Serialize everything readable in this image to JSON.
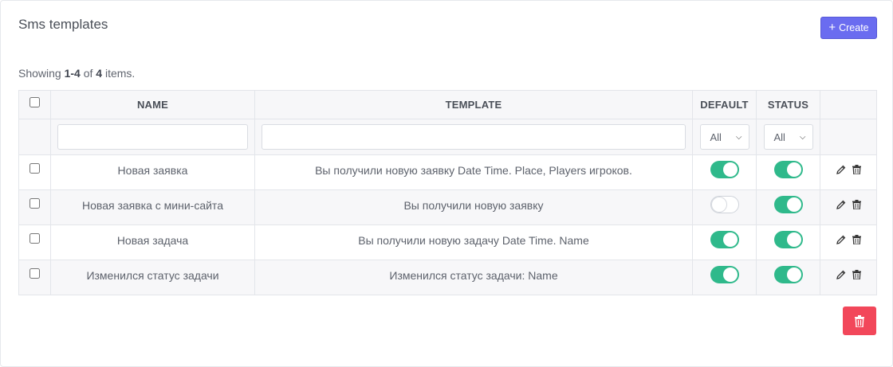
{
  "header": {
    "title": "Sms templates",
    "create_label": "Create"
  },
  "summary": {
    "prefix": "Showing",
    "range": "1-4",
    "of": "of",
    "total": "4",
    "suffix": "items."
  },
  "table": {
    "columns": {
      "name": "NAME",
      "template": "TEMPLATE",
      "default": "DEFAULT",
      "status": "STATUS"
    },
    "filters": {
      "default_selected": "All",
      "status_selected": "All",
      "name_value": "",
      "template_value": ""
    },
    "rows": [
      {
        "name": "Новая заявка",
        "template": "Вы получили новую заявку Date Time. Place, Players игроков.",
        "default": true,
        "status": true
      },
      {
        "name": "Новая заявка с мини-сайта",
        "template": "Вы получили новую заявку",
        "default": false,
        "status": true
      },
      {
        "name": "Новая задача",
        "template": "Вы получили новую задачу Date Time. Name",
        "default": true,
        "status": true
      },
      {
        "name": "Изменился статус задачи",
        "template": "Изменился статус задачи: Name",
        "default": true,
        "status": true
      }
    ]
  },
  "icons": {
    "create": "plus-icon",
    "edit": "pencil-icon",
    "delete": "trash-icon",
    "bulk_delete": "trash-icon"
  },
  "colors": {
    "accent": "#6a6cf0",
    "toggle_on": "#2fb98b",
    "danger": "#f2475a"
  }
}
